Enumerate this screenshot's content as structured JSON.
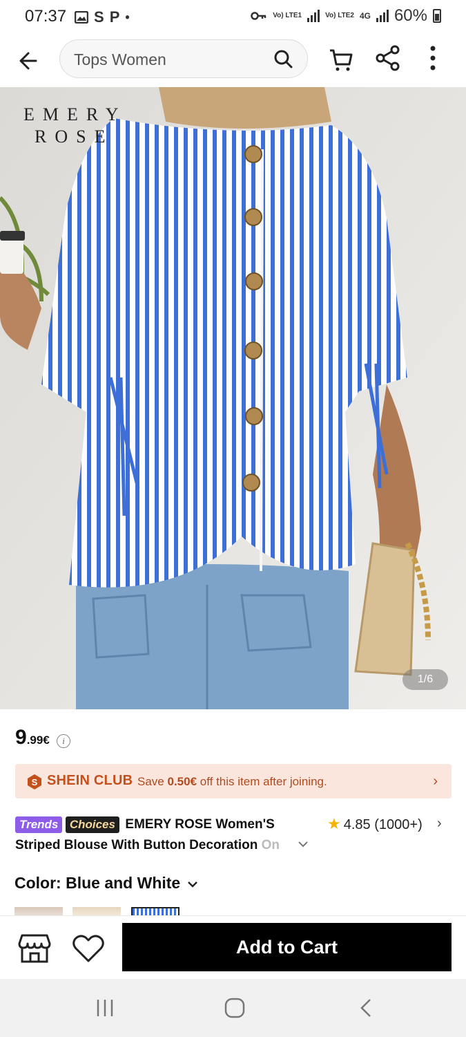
{
  "status_bar": {
    "time": "07:37",
    "left_icons": [
      "image-icon",
      "S",
      "P",
      "•"
    ],
    "sim1": "Vo) LTE1",
    "sim2": "Vo) LTE2",
    "network": "4G",
    "battery": "60%"
  },
  "app_bar": {
    "search_query": "Tops Women"
  },
  "gallery": {
    "brand_line1": "EMERY",
    "brand_line2": "ROSE",
    "counter": "1/6"
  },
  "price": {
    "integer": "9",
    "fraction": ".99€",
    "info_icon": "i"
  },
  "club": {
    "badge": "S",
    "name": "SHEIN CLUB",
    "text_prefix": "Save ",
    "amount": "0.50€",
    "text_suffix": " off this item after joining.",
    "chevron": "›"
  },
  "product": {
    "tag_trends": "Trends",
    "tag_choices": "Choices",
    "title_line1": "EMERY ROSE Women'S",
    "title_line2": "Striped Blouse With Button Decoration",
    "title_line2_fade": " On",
    "rating_value": "4.85",
    "rating_count": "(1000+)",
    "rating_chevron": "›"
  },
  "color": {
    "label": "Color: Blue and White"
  },
  "actions": {
    "add_to_cart": "Add to Cart"
  },
  "colors": {
    "accent": "#c4511c",
    "club_bg": "#fbe6dd",
    "stripe_blue": "#3d6fd6",
    "cta_bg": "#000000",
    "star": "#f4b400"
  }
}
